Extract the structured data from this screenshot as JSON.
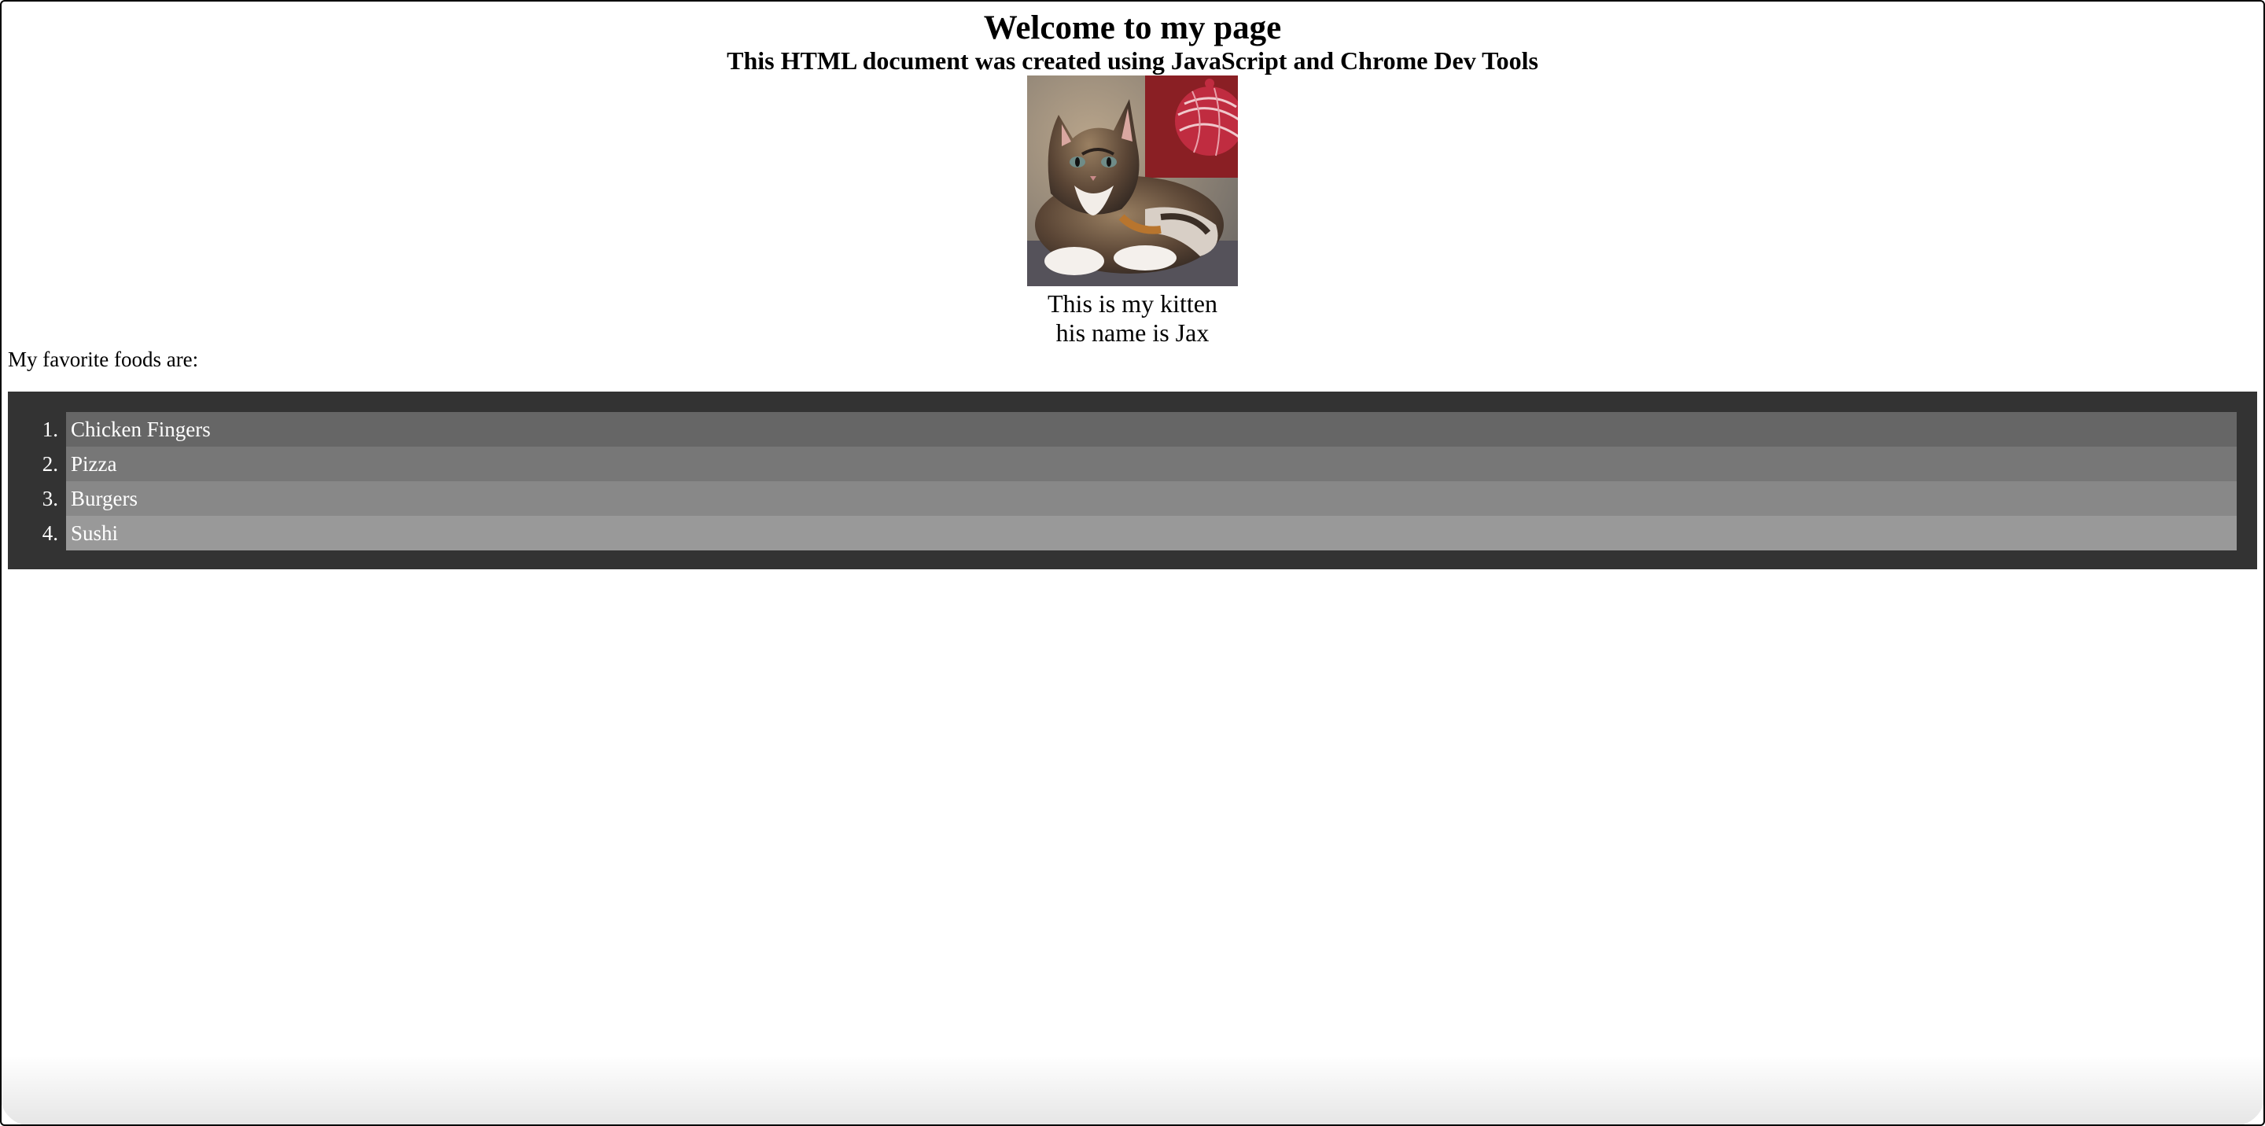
{
  "page": {
    "title": "Welcome to my page",
    "subtitle": "This HTML document was created using JavaScript and Chrome Dev Tools"
  },
  "kitten": {
    "image_name": "kitten-photo",
    "caption_line1": "This is my kitten",
    "caption_line2": "his name is Jax"
  },
  "foods": {
    "intro": "My favorite foods are:",
    "items": [
      {
        "num": "1.",
        "label": "Chicken Fingers",
        "bg": "#666666"
      },
      {
        "num": "2.",
        "label": "Pizza",
        "bg": "#777777"
      },
      {
        "num": "3.",
        "label": "Burgers",
        "bg": "#888888"
      },
      {
        "num": "4.",
        "label": "Sushi",
        "bg": "#999999"
      }
    ],
    "list_bg": "#333333"
  }
}
